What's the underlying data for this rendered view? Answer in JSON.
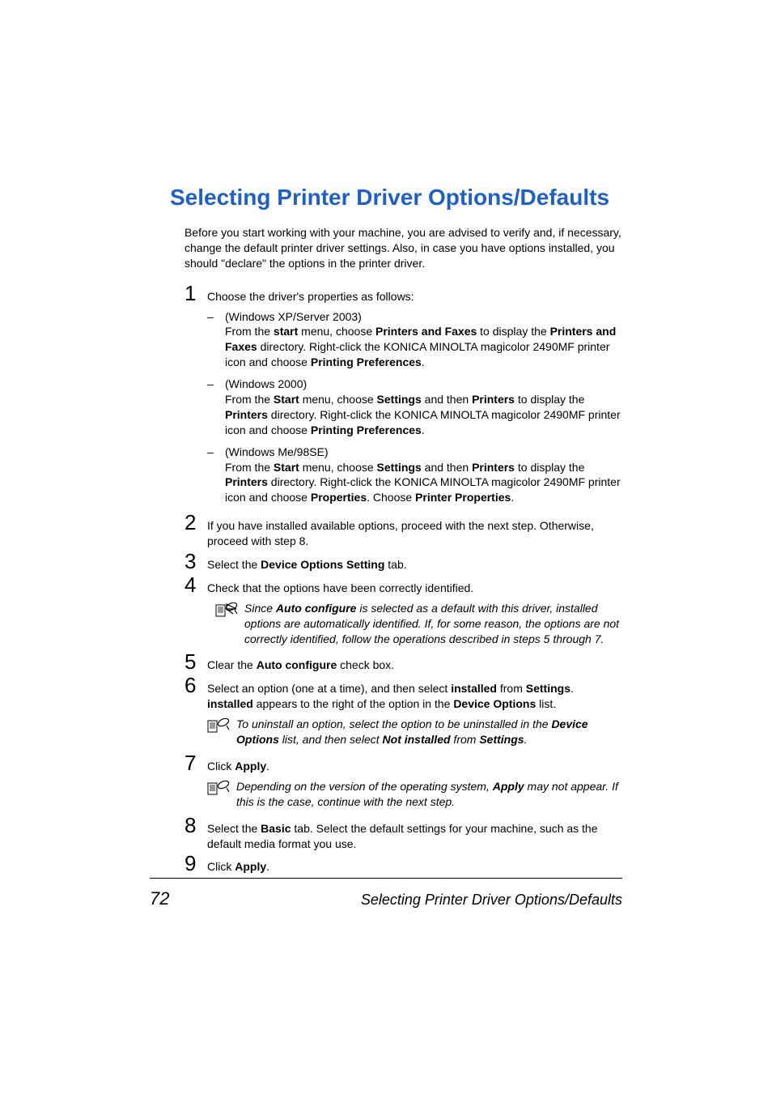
{
  "heading": "Selecting Printer Driver Options/Defaults",
  "intro": "Before you start working with your machine, you are advised to verify and, if necessary, change the default printer driver settings. Also, in case you have options installed, you should \"declare\" the options in the printer driver.",
  "step1_text": "Choose the driver's properties as follows:",
  "sub1_label": "(Windows XP/Server 2003)",
  "sub1_p1": "From the ",
  "sub1_b1": "start",
  "sub1_p2": " menu, choose ",
  "sub1_b2": "Printers and Faxes",
  "sub1_p3": " to display the ",
  "sub1_b3": "Printers and Faxes",
  "sub1_p4": " directory. Right-click the KONICA MINOLTA magicolor 2490MF printer icon and choose ",
  "sub1_b4": "Printing Preferences",
  "sub1_p5": ".",
  "sub2_label": "(Windows 2000)",
  "sub2_p1": "From the ",
  "sub2_b1": "Start",
  "sub2_p2": " menu, choose ",
  "sub2_b2": "Settings",
  "sub2_p3": " and then ",
  "sub2_b3": "Printers",
  "sub2_p4": " to display the ",
  "sub2_b4": "Printers",
  "sub2_p5": " directory. Right-click the KONICA MINOLTA magicolor 2490MF printer icon and choose ",
  "sub2_b5": "Printing Preferences",
  "sub2_p6": ".",
  "sub3_label": "(Windows Me/98SE)",
  "sub3_p1": "From the ",
  "sub3_b1": "Start",
  "sub3_p2": " menu, choose ",
  "sub3_b2": "Settings",
  "sub3_p3": " and then ",
  "sub3_b3": "Printers",
  "sub3_p4": " to display the ",
  "sub3_b4": "Printers",
  "sub3_p5": " directory. Right-click the KONICA MINOLTA magicolor 2490MF printer icon and choose ",
  "sub3_b5": "Properties",
  "sub3_p6": ". Choose ",
  "sub3_b6": "Printer Properties",
  "sub3_p7": ".",
  "step2_text": "If you have installed available options, proceed with the next step. Otherwise, proceed with step 8.",
  "step3_p1": "Select the ",
  "step3_b1": "Device Options Setting",
  "step3_p2": " tab.",
  "step4_text": "Check that the options have been correctly identified.",
  "note4_p1": "Since ",
  "note4_b1": "Auto configure",
  "note4_p2": " is selected as a default with this driver, installed options are automatically identified. If, for some reason, the options are not correctly identified, follow the operations described in steps 5 through 7.",
  "step5_p1": "Clear the ",
  "step5_b1": "Auto configure",
  "step5_p2": " check box.",
  "step6_p1": "Select an option (one at a time), and then select ",
  "step6_b1": "installed",
  "step6_p2": " from ",
  "step6_b2": "Settings",
  "step6_p3": ". ",
  "step6_b3": "installed",
  "step6_p4": " appears to the right of the option in the ",
  "step6_b4": "Device Options",
  "step6_p5": " list.",
  "note6_p1": "To uninstall an option, select the option to be uninstalled in the ",
  "note6_b1": "Device Options",
  "note6_p2": " list, and then select ",
  "note6_b2": "Not installed",
  "note6_p3": " from ",
  "note6_b3": "Settings",
  "note6_p4": ".",
  "step7_p1": "Click ",
  "step7_b1": "Apply",
  "step7_p2": ".",
  "note7_p1": "Depending on the version of the operating system, ",
  "note7_b1": "Apply",
  "note7_p2": " may not appear. If this is the case, continue with the next step.",
  "step8_p1": "Select the ",
  "step8_b1": "Basic",
  "step8_p2": " tab. Select the default settings for your machine, such as the default media format you use.",
  "step9_p1": "Click ",
  "step9_b1": "Apply",
  "step9_p2": ".",
  "page_number": "72",
  "footer_title": "Selecting Printer Driver Options/Defaults",
  "numbers": {
    "n1": "1",
    "n2": "2",
    "n3": "3",
    "n4": "4",
    "n5": "5",
    "n6": "6",
    "n7": "7",
    "n8": "8",
    "n9": "9"
  },
  "dash": "–"
}
